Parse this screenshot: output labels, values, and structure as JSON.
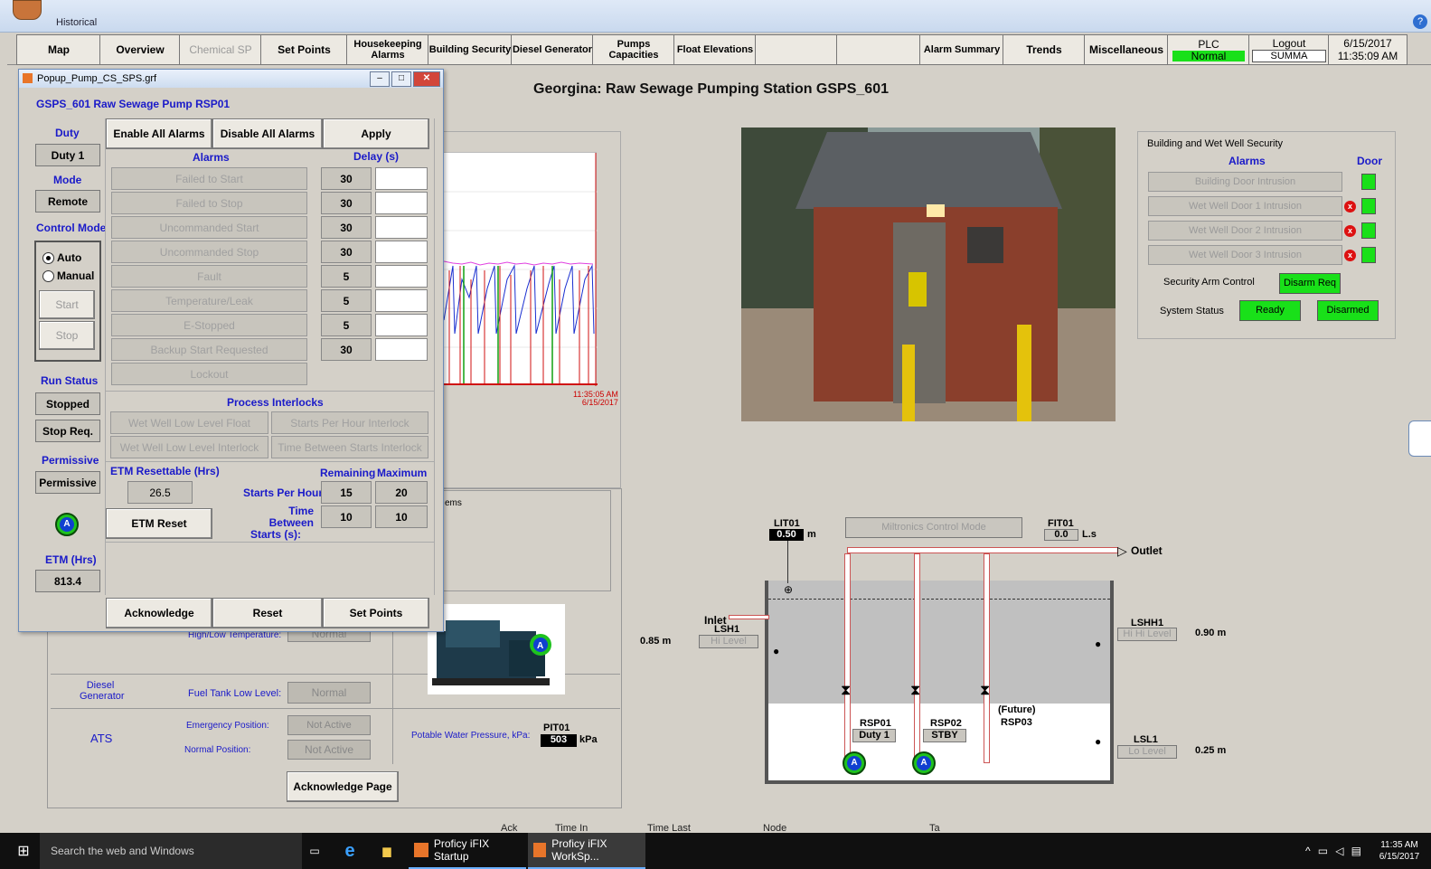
{
  "app": {
    "name": "Historical"
  },
  "nav": {
    "items": [
      "Map",
      "Overview",
      "Chemical SP",
      "Set Points",
      "Housekeeping Alarms",
      "Building Security",
      "Diesel Generator",
      "Pumps Capacities",
      "Float Elevations",
      "",
      "",
      "Alarm Summary",
      "Trends",
      "Miscellaneous"
    ],
    "plc_label": "PLC",
    "plc_status": "Normal",
    "logout_label": "Logout",
    "logout_user": "SUMMA",
    "date": "6/15/2017",
    "time": "11:35:09 AM"
  },
  "page": {
    "title": "Georgina: Raw Sewage Pumping Station GSPS_601"
  },
  "trend": {
    "time_line1": "11:35:05 AM",
    "time_line2": "6/15/2017"
  },
  "popup": {
    "window_title": "Popup_Pump_CS_SPS.grf",
    "heading": "GSPS_601 Raw Sewage Pump RSP01",
    "duty_label": "Duty",
    "duty_value": "Duty 1",
    "mode_label": "Mode",
    "mode_value": "Remote",
    "control_mode_label": "Control Mode",
    "auto_label": "Auto",
    "manual_label": "Manual",
    "start_label": "Start",
    "stop_label": "Stop",
    "run_status_label": "Run Status",
    "run_status_value": "Stopped",
    "stop_req_label": "Stop Req.",
    "permissive_label": "Permissive",
    "permissive_value": "Permissive",
    "etm_label": "ETM (Hrs)",
    "etm_value": "813.4",
    "enable_all_label": "Enable All Alarms",
    "disable_all_label": "Disable All Alarms",
    "apply_label": "Apply",
    "alarms_header": "Alarms",
    "delay_header": "Delay (s)",
    "alarms": [
      {
        "name": "Failed to Start",
        "delay": "30"
      },
      {
        "name": "Failed to Stop",
        "delay": "30"
      },
      {
        "name": "Uncommanded Start",
        "delay": "30"
      },
      {
        "name": "Uncommanded Stop",
        "delay": "30"
      },
      {
        "name": "Fault",
        "delay": "5"
      },
      {
        "name": "Temperature/Leak",
        "delay": "5"
      },
      {
        "name": "E-Stopped",
        "delay": "5"
      },
      {
        "name": "Backup Start Requested",
        "delay": "30"
      },
      {
        "name": "Lockout",
        "delay": ""
      }
    ],
    "interlocks_header": "Process Interlocks",
    "interlocks": [
      "Wet Well Low Level Float",
      "Starts Per Hour Interlock",
      "Wet Well Low Level Interlock",
      "Time Between Starts  Interlock"
    ],
    "etm_resettable_label": "ETM Resettable (Hrs)",
    "etm_resettable_value": "26.5",
    "remaining_label": "Remaining",
    "maximum_label": "Maximum",
    "starts_per_hour_label": "Starts Per Hour:",
    "starts_per_hour_remaining": "15",
    "starts_per_hour_max": "20",
    "time_between_label_1": "Time Between",
    "time_between_label_2": "Starts (s):",
    "time_between_remaining": "10",
    "time_between_max": "10",
    "etm_reset_label": "ETM Reset",
    "acknowledge_label": "Acknowledge",
    "reset_label": "Reset",
    "set_points_label": "Set Points"
  },
  "lower": {
    "alarm_sub_text": "ems",
    "high_low_temp_label": "High/Low Temperature:",
    "high_low_temp_value": "Normal",
    "diesel_label_1": "Diesel",
    "diesel_label_2": "Generator",
    "fuel_tank_label": "Fuel Tank Low Level:",
    "fuel_tank_value": "Normal",
    "ats_label": "ATS",
    "emergency_label": "Emergency Position:",
    "emergency_value": "Not Active",
    "normal_pos_label": "Normal Position:",
    "normal_pos_value": "Not Active",
    "potable_label": "Potable Water Pressure, kPa:",
    "pit_tag": "PIT01",
    "pit_value": "503",
    "pit_unit": "kPa",
    "ack_page_label": "Acknowledge Page"
  },
  "security": {
    "title": "Building and Wet Well Security",
    "alarms_header": "Alarms",
    "door_header": "Door",
    "rows": [
      "Building Door Intrusion",
      "Wet Well  Door 1 Intrusion",
      "Wet Well  Door 2 Intrusion",
      "Wet Well  Door 3 Intrusion"
    ],
    "arm_label": "Security Arm Control",
    "arm_button": "Disarm Req",
    "status_label": "System Status",
    "status_ready": "Ready",
    "status_disarmed": "Disarmed",
    "ok_color": "#19e019"
  },
  "wetwell": {
    "lit_tag": "LIT01",
    "lit_value": "0.50",
    "lit_unit": "m",
    "miltronics": "Miltronics Control Mode",
    "fit_tag": "FIT01",
    "fit_value": "0.0",
    "fit_unit": "L.s",
    "outlet": "Outlet",
    "inlet": "Inlet",
    "lsh_tag": "LSH1",
    "lsh_value": "Hi Level",
    "lsh_elev": "0.85 m",
    "lshh_tag": "LSHH1",
    "lshh_value": "Hi Hi Level",
    "lshh_elev": "0.90 m",
    "lsl_tag": "LSL1",
    "lsl_value": "Lo Level",
    "lsl_elev": "0.25 m",
    "rsp01_tag": "RSP01",
    "rsp01_duty": "Duty 1",
    "rsp02_tag": "RSP02",
    "rsp02_duty": "STBY",
    "rsp03_future": "(Future)",
    "rsp03_tag": "RSP03",
    "pump_letter": "A"
  },
  "alarm_header": {
    "cols": [
      "Ack",
      "Time In",
      "Time Last",
      "Node",
      "Ta"
    ]
  },
  "taskbar": {
    "search": "Search the web and Windows",
    "app1": "Proficy iFIX Startup",
    "app2": "Proficy iFIX WorkSp...",
    "clock_time": "11:35 AM",
    "clock_date": "6/15/2017"
  }
}
